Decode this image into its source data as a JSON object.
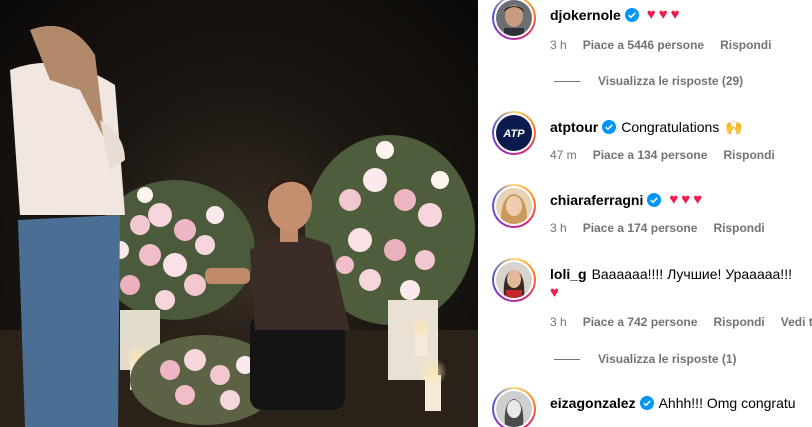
{
  "comments": [
    {
      "username": "djokernole",
      "verified": true,
      "text": "",
      "hearts": "♥♥♥",
      "time": "3 h",
      "likes": "Piace a 5446 persone",
      "reply": "Rispondi",
      "view_replies": "Visualizza le risposte (29)"
    },
    {
      "username": "atptour",
      "verified": true,
      "text": "Congratulations",
      "emoji": "🙌",
      "time": "47 m",
      "likes": "Piace a 134 persone",
      "reply": "Rispondi"
    },
    {
      "username": "chiaraferragni",
      "verified": true,
      "text": "",
      "hearts": "♥♥♥",
      "time": "3 h",
      "likes": "Piace a 174 persone",
      "reply": "Rispondi"
    },
    {
      "username": "loli_g",
      "verified": false,
      "text": "Baaaaaa!!!! Лучшие! Урааааа!!!",
      "hearts": "♥",
      "time": "3 h",
      "likes": "Piace a 742 persone",
      "reply": "Rispondi",
      "translate": "Vedi t",
      "view_replies": "Visualizza le risposte (1)"
    },
    {
      "username": "eizagonzalez",
      "verified": true,
      "text": "Ahhh!!! Omg congratu"
    }
  ],
  "colors": {
    "verified_blue": "#0095f6",
    "heart_red": "#ed1f4d",
    "meta_gray": "#737373"
  },
  "icons": [
    "verified-badge-icon",
    "atp-logo-icon"
  ]
}
